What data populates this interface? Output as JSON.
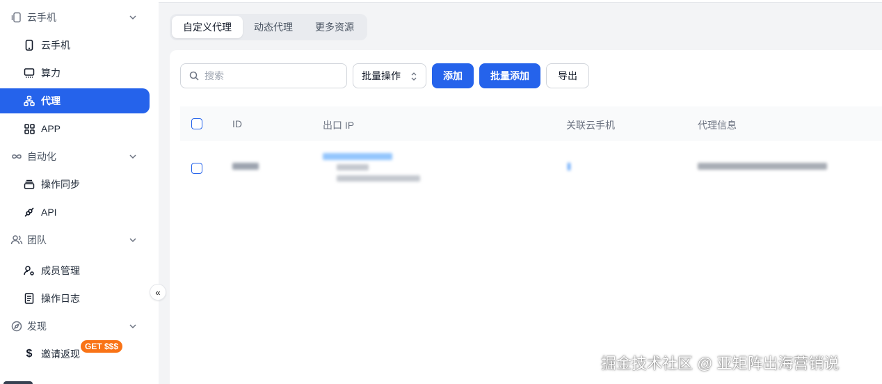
{
  "sidebar": {
    "groups": {
      "cloud_phone": "云手机",
      "automation": "自动化",
      "team": "团队",
      "discover": "发现"
    },
    "items": {
      "cloud_phone": "云手机",
      "compute": "算力",
      "proxy": "代理",
      "app": "APP",
      "sync": "操作同步",
      "api": "API",
      "members": "成员管理",
      "log": "操作日志",
      "invite": "邀请返现"
    },
    "invite_badge": "GET $$$",
    "collapse_glyph": "«"
  },
  "tabs": [
    "自定义代理",
    "动态代理",
    "更多资源"
  ],
  "toolbar": {
    "search_placeholder": "搜索",
    "batch_label": "批量操作",
    "add_label": "添加",
    "batch_add_label": "批量添加",
    "export_label": "导出"
  },
  "table": {
    "columns": [
      "ID",
      "出口 IP",
      "关联云手机",
      "代理信息"
    ]
  },
  "watermark": "掘金技术社区 @ 亚矩阵出海营销说",
  "colors": {
    "accent": "#2563eb",
    "badge": "#f97316"
  }
}
